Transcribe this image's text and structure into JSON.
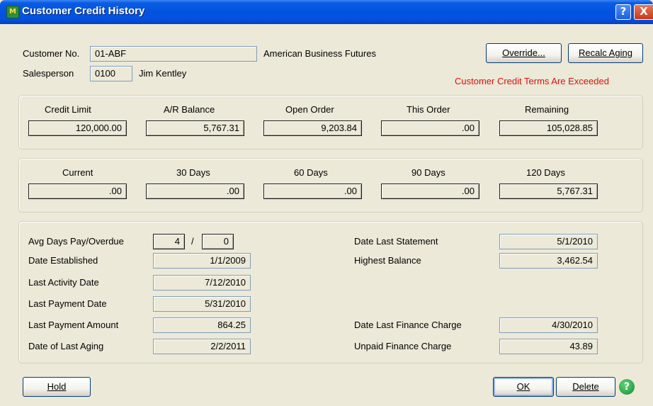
{
  "window": {
    "title": "Customer Credit History",
    "app_icon": "M",
    "help_button": "?",
    "close_button": "X"
  },
  "header": {
    "customer_no_label": "Customer No.",
    "customer_no": "01-ABF",
    "customer_name": "American Business Futures",
    "salesperson_label": "Salesperson",
    "salesperson_code": "0100",
    "salesperson_name": "Jim Kentley",
    "override_label": "Override...",
    "recalc_label": "Recalc Aging",
    "warning": "Customer Credit Terms Are Exceeded"
  },
  "credit": {
    "labels": [
      "Credit Limit",
      "A/R Balance",
      "Open Order",
      "This Order",
      "Remaining"
    ],
    "values": [
      "120,000.00",
      "5,767.31",
      "9,203.84",
      ".00",
      "105,028.85"
    ]
  },
  "aging": {
    "labels": [
      "Current",
      "30 Days",
      "60 Days",
      "90 Days",
      "120 Days"
    ],
    "values": [
      ".00",
      ".00",
      ".00",
      ".00",
      "5,767.31"
    ]
  },
  "history": {
    "avg_days_label": "Avg Days Pay/Overdue",
    "avg_days_pay": "4",
    "slash": "/",
    "avg_days_overdue": "0",
    "date_established_label": "Date Established",
    "date_established": "1/1/2009",
    "last_activity_label": "Last Activity Date",
    "last_activity": "7/12/2010",
    "last_payment_date_label": "Last Payment Date",
    "last_payment_date": "5/31/2010",
    "last_payment_amount_label": "Last Payment Amount",
    "last_payment_amount": "864.25",
    "last_aging_label": "Date of Last Aging",
    "last_aging": "2/2/2011",
    "last_statement_label": "Date Last Statement",
    "last_statement": "5/1/2010",
    "highest_balance_label": "Highest Balance",
    "highest_balance": "3,462.54",
    "last_finance_label": "Date Last Finance Charge",
    "last_finance": "4/30/2010",
    "unpaid_finance_label": "Unpaid Finance Charge",
    "unpaid_finance": "43.89"
  },
  "footer": {
    "hold_label": "Hold",
    "ok_label": "OK",
    "delete_label": "Delete",
    "help_icon": "?"
  }
}
